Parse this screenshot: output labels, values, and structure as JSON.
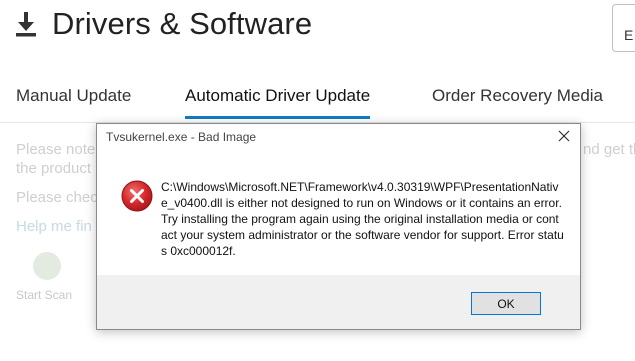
{
  "page": {
    "title": "Drivers & Software",
    "top_right_button": "E"
  },
  "tabs": [
    {
      "label": "Manual Update"
    },
    {
      "label": "Automatic Driver Update"
    },
    {
      "label": "Order Recovery Media"
    }
  ],
  "background_text": {
    "line1_left": "Please note",
    "line1_right": "nd get the",
    "line2": "the product",
    "line3": "Please chec",
    "help_link": "Help me fin",
    "start_scan": "Start Scan"
  },
  "dialog": {
    "title": "Tvsukernel.exe - Bad Image",
    "message": "C:\\Windows\\Microsoft.NET\\Framework\\v4.0.30319\\WPF\\PresentationNative_v0400.dll is either not designed to run on Windows or it contains an error. Try installing the program again using the original installation media or contact your system administrator or the software vendor for support. Error status 0xc000012f.",
    "ok_label": "OK"
  },
  "colors": {
    "accent": "#1479c4",
    "error_red": "#d3252a"
  }
}
